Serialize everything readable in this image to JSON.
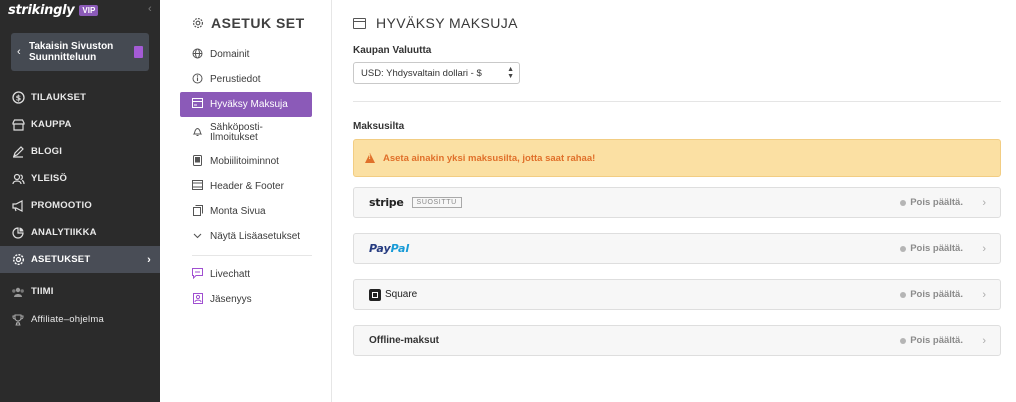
{
  "brand": {
    "name": "strikingly",
    "badge": "VIP"
  },
  "back_button": {
    "label": "Takaisin Sivuston Suunnitteluun"
  },
  "sidebar": {
    "items": [
      {
        "label": "TILAUKSET",
        "icon": "dollar-circle-icon"
      },
      {
        "label": "KAUPPA",
        "icon": "store-icon"
      },
      {
        "label": "BLOGI",
        "icon": "pen-icon"
      },
      {
        "label": "YLEISÖ",
        "icon": "users-icon"
      },
      {
        "label": "PROMOOTIO",
        "icon": "megaphone-icon"
      },
      {
        "label": "ANALYTIIKKA",
        "icon": "pie-chart-icon"
      },
      {
        "label": "ASETUKSET",
        "icon": "gear-icon"
      },
      {
        "label": "TIIMI",
        "icon": "team-icon"
      },
      {
        "label": "Affiliate–ohjelma",
        "icon": "trophy-icon"
      }
    ]
  },
  "settings": {
    "title": "ASETUK SET",
    "items": [
      {
        "label": "Domainit",
        "icon": "globe-icon"
      },
      {
        "label": "Perustiedot",
        "icon": "info-icon"
      },
      {
        "label": "Hyväksy Maksuja",
        "icon": "card-icon"
      },
      {
        "label": "Sähköposti-Ilmoitukset",
        "line1": "Sähköposti-",
        "line2": "Ilmoitukset",
        "icon": "bell-icon"
      },
      {
        "label": "Mobiilitoiminnot",
        "icon": "mobile-icon"
      },
      {
        "label": "Header & Footer",
        "icon": "layout-icon"
      },
      {
        "label": "Monta Sivua",
        "icon": "pages-icon"
      },
      {
        "label": "Näytä Lisäasetukset",
        "icon": "chevron-down-icon"
      },
      {
        "label": "Livechatt",
        "icon": "chat-icon"
      },
      {
        "label": "Jäsenyys",
        "icon": "member-icon"
      }
    ]
  },
  "main": {
    "title": "HYVÄKSY MAKSUJA",
    "currency_label": "Kaupan Valuutta",
    "currency_value": "USD: Yhdysvaltain dollari - $",
    "gateways_label": "Maksusilta",
    "warning": "Aseta ainakin yksi maksusilta, jotta saat rahaa!",
    "gateways": [
      {
        "name": "stripe",
        "badge": "SUOSITTU",
        "status": "Pois päältä."
      },
      {
        "name_part1": "Pay",
        "name_part2": "Pal",
        "status": "Pois päältä."
      },
      {
        "name": "Square",
        "status": "Pois päältä."
      },
      {
        "name": "Offline-maksut",
        "status": "Pois päältä."
      }
    ]
  },
  "colors": {
    "accent": "#8b5ab8",
    "sidebar_bg": "#2b2b2b",
    "warning_bg": "#fbe0a3",
    "warning_text": "#e0702a"
  }
}
